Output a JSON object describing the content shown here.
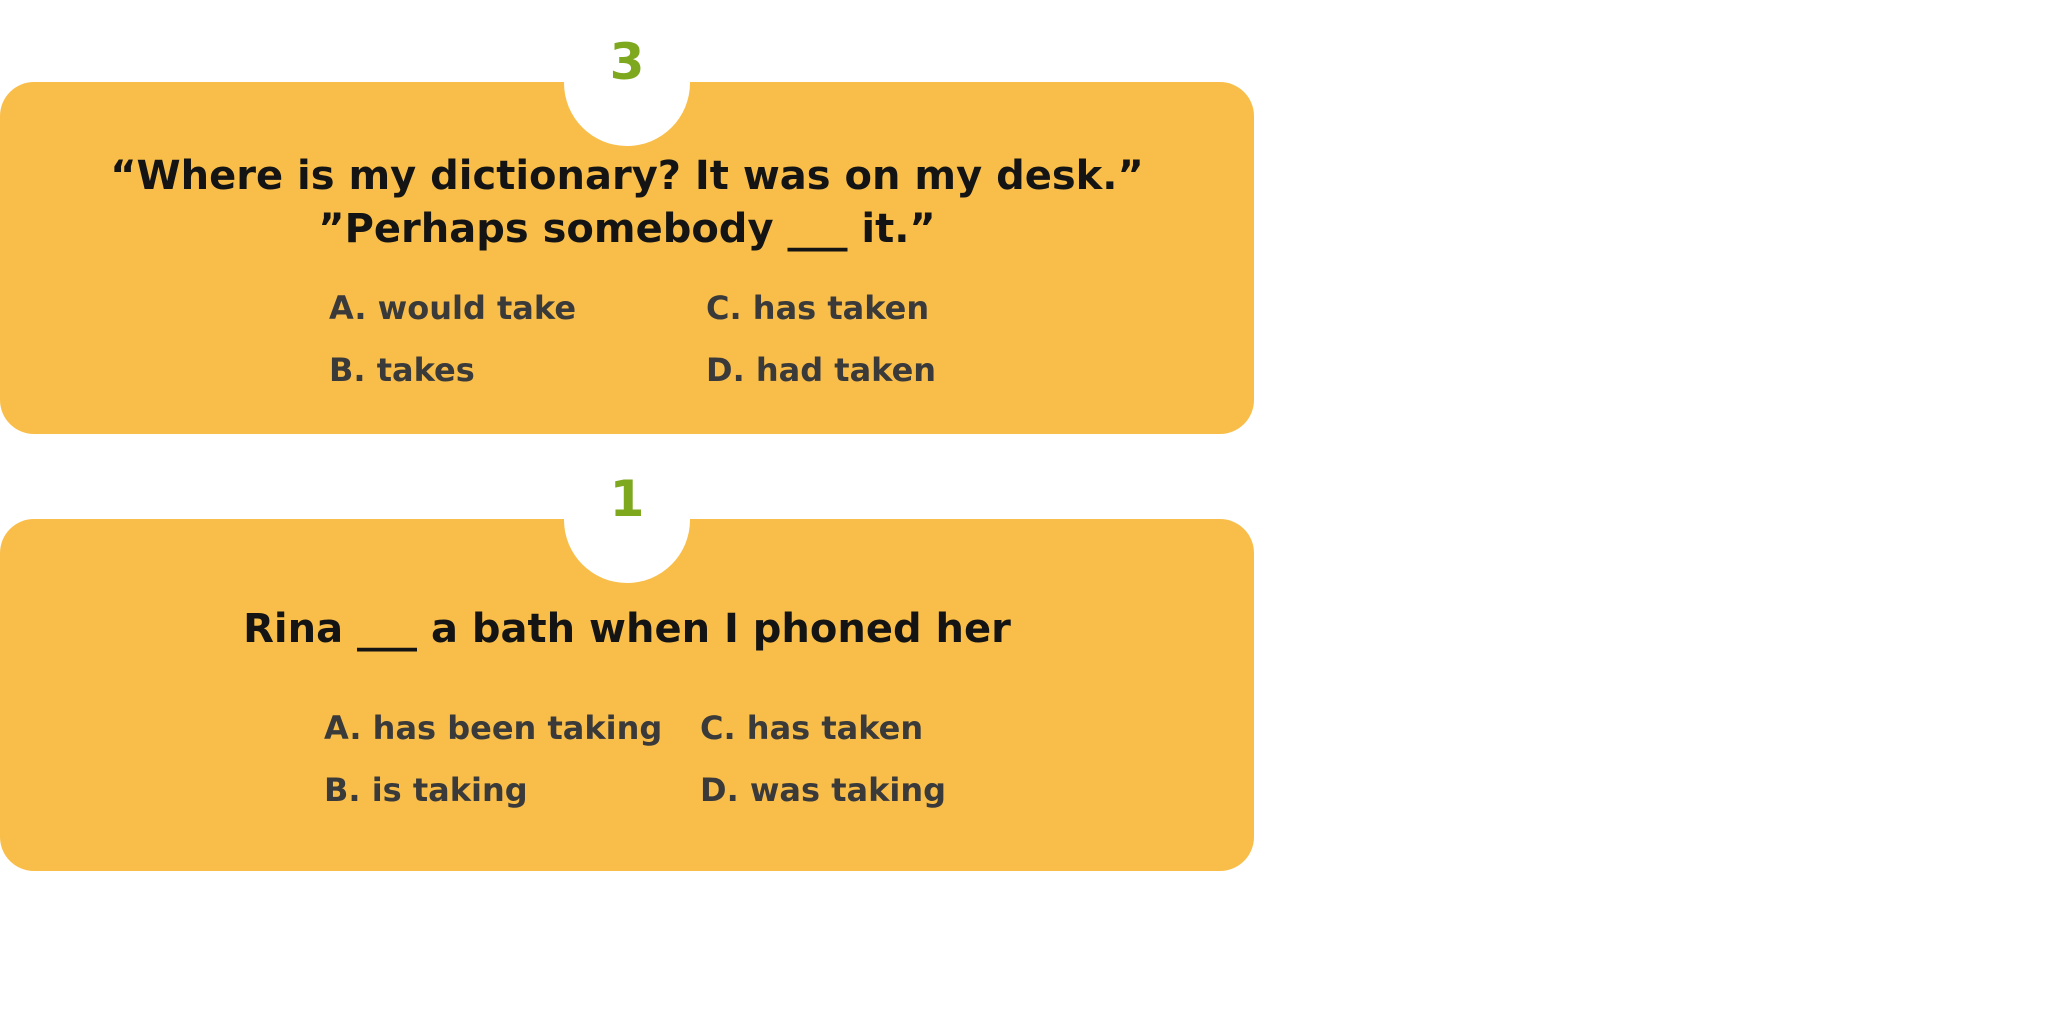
{
  "colors": {
    "card_background": "#F9BE4A",
    "number_color": "#7EA81E"
  },
  "questions": [
    {
      "number": "3",
      "lines": [
        "“Where is my dictionary? It was on my desk.”",
        "”Perhaps somebody ___  it.”"
      ],
      "options": {
        "a": "A. would take",
        "b": "B. takes",
        "c": "C. has taken",
        "d": "D. had taken"
      }
    },
    {
      "number": "1",
      "lines": [
        "Rina ___  a bath when I phoned her"
      ],
      "options": {
        "a": "A. has been taking",
        "b": "B. is taking",
        "c": "C. has taken",
        "d": "D. was taking"
      }
    }
  ]
}
